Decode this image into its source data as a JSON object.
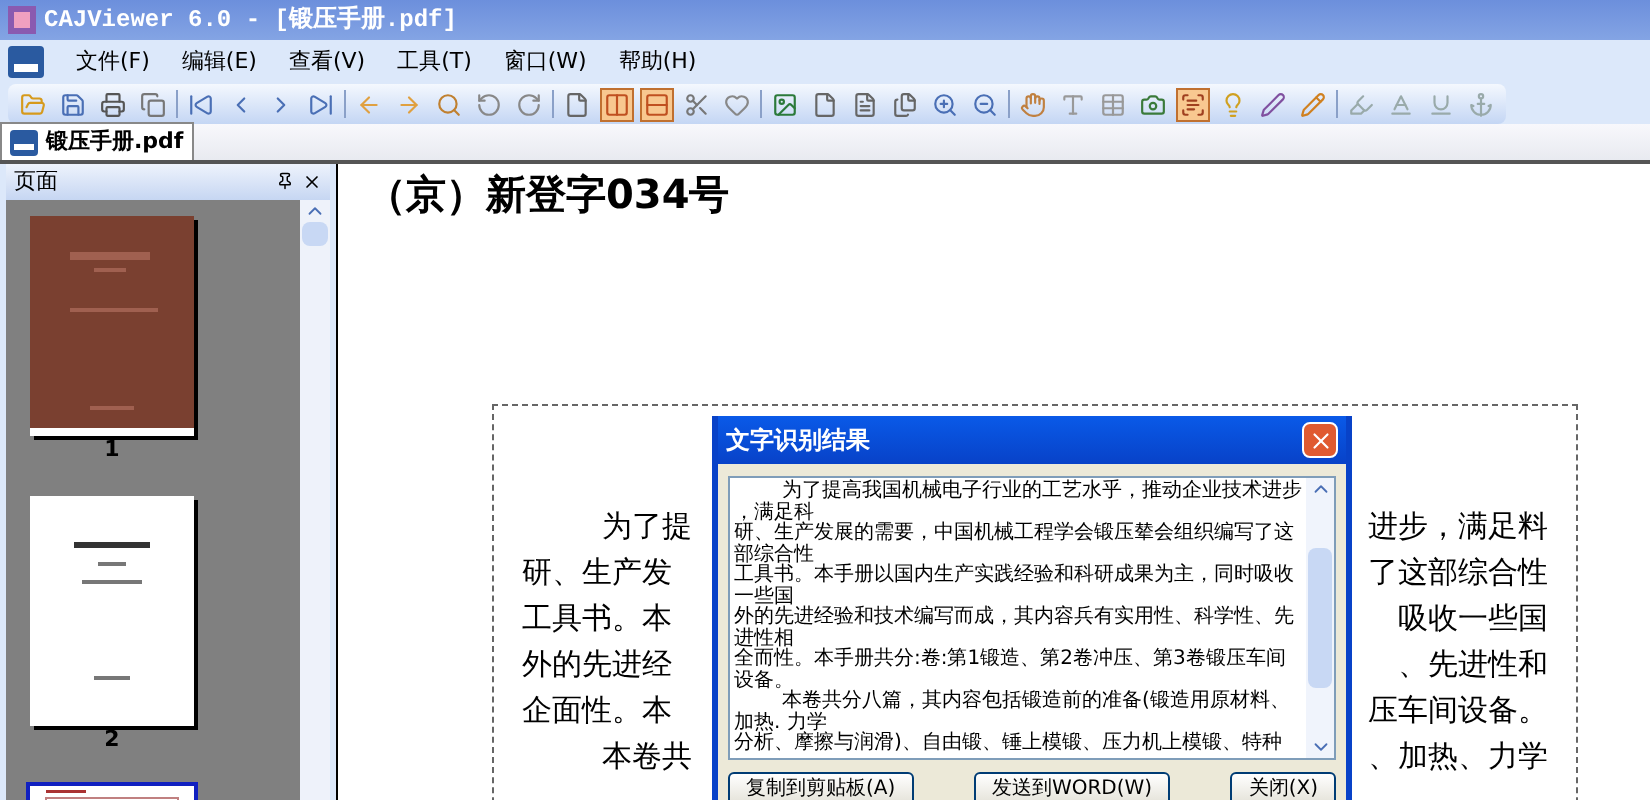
{
  "window": {
    "title": "CAJViewer 6.0 - [锻压手册.pdf]"
  },
  "menu": [
    "文件(F)",
    "编辑(E)",
    "查看(V)",
    "工具(T)",
    "窗口(W)",
    "帮助(H)"
  ],
  "toolbar": [
    {
      "selected": false
    },
    {
      "selected": false
    },
    {
      "selected": false
    },
    {
      "selected": false
    },
    {
      "selected": false
    },
    {
      "selected": false
    },
    {
      "selected": false
    },
    {
      "selected": false
    },
    {
      "selected": false
    },
    {
      "selected": false
    },
    {
      "selected": false
    },
    {
      "selected": false
    },
    {
      "selected": false
    },
    {
      "selected": false
    },
    {
      "selected": true
    },
    {
      "selected": true
    },
    {
      "selected": false
    },
    {
      "selected": false
    },
    {
      "selected": false
    },
    {
      "selected": false
    },
    {
      "selected": false
    },
    {
      "selected": false
    },
    {
      "selected": false
    },
    {
      "selected": false
    },
    {
      "selected": false
    },
    {
      "selected": false
    },
    {
      "selected": false
    },
    {
      "selected": false
    },
    {
      "selected": true
    },
    {
      "selected": false
    },
    {
      "selected": false
    },
    {
      "selected": false
    },
    {
      "selected": false
    },
    {
      "selected": false
    },
    {
      "selected": false
    },
    {
      "selected": false
    }
  ],
  "tabs": [
    {
      "label": "锻压手册.pdf",
      "selected": true
    }
  ],
  "pages_panel": {
    "title": "页面",
    "thumbnails": [
      {
        "kind": "cover",
        "label": "1",
        "selected": false
      },
      {
        "kind": "title",
        "label": "2",
        "selected": false
      },
      {
        "kind": "text",
        "selected": true
      }
    ]
  },
  "document": {
    "heading": "（京）新登字034号",
    "rows": [
      {
        "left": "为了提",
        "right": "进步，满足料",
        "indent": true
      },
      {
        "left": "研、生产发",
        "right": "了这部综合性",
        "indent": false
      },
      {
        "left": "工具书。本",
        "right": "吸收一些国",
        "indent": false
      },
      {
        "left": "外的先进经",
        "right": "、先进性和",
        "indent": false
      },
      {
        "left": "企面性。本",
        "right": "压车间设备。",
        "indent": false
      },
      {
        "left": "本卷共",
        "right": "、加热、力学",
        "indent": true
      }
    ]
  },
  "dialog": {
    "title": "文字识别结果",
    "lines": [
      {
        "text": "为了提高我国机械电子行业的工艺水乎，推动企业技术进步",
        "indent": true
      },
      {
        "text": "，满足科",
        "indent": false
      },
      {
        "text": "研、生产发展的需要，中国机械工程学会锻压辇会组织编写了这",
        "indent": false
      },
      {
        "text": "部综合性",
        "indent": false
      },
      {
        "text": "工具书。本手册以国内生产实践经验和科研成果为主，同时吸收",
        "indent": false
      },
      {
        "text": "一些国",
        "indent": false
      },
      {
        "text": "外的先进经验和技术编写而成，其内容兵有实用性、科学性、先",
        "indent": false
      },
      {
        "text": "进性相",
        "indent": false
      },
      {
        "text": "全而性。本手册共分:卷:第1锻造、第2卷冲压、第3卷锻压车间",
        "indent": false
      },
      {
        "text": "设备。",
        "indent": false
      },
      {
        "text": "本卷共分八篇，其内容包括锻造前的准备(锻造用原材料、",
        "indent": true
      },
      {
        "text": "加热. 力学",
        "indent": false
      },
      {
        "text": "分析、摩擦与润滑)、自由锻、锤上模锻、压力机上模锻、特种",
        "indent": false
      }
    ],
    "buttons": [
      "复制到剪贴板(A)",
      "发送到WORD(W)",
      "关闭(X)"
    ]
  }
}
